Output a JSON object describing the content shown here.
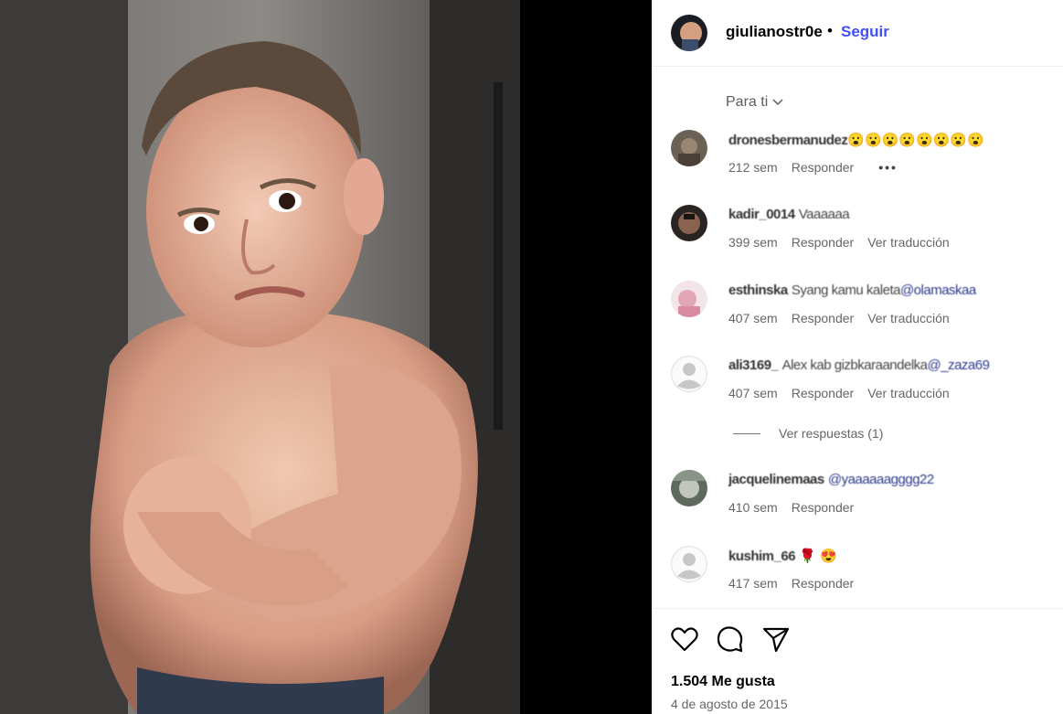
{
  "post": {
    "author": "giulianostr0e",
    "follow_label": "Seguir",
    "separator": "•",
    "filter_label": "Para ti",
    "likes": "1.504 Me gusta",
    "date": "4 de agosto de 2015"
  },
  "reply_label": "Responder",
  "translate_label": "Ver traducción",
  "view_replies_label": "Ver respuestas (1)",
  "comments": [
    {
      "user": "dronesbermanudez",
      "text": "😮😮😮😮😮😮😮😮",
      "mention": "",
      "time": "212 sem"
    },
    {
      "user": "kadir_0014",
      "text": "Vaaaaaa",
      "mention": "",
      "time": "399 sem"
    },
    {
      "user": "esthinska",
      "text": "Syang kamu kaleta",
      "mention": "@olamaskaa",
      "time": "407 sem"
    },
    {
      "user": "ali3169_",
      "text": "Alex kab gizbkaraandelka",
      "mention": "@_zaza69",
      "time": "407 sem"
    },
    {
      "user": "jacquelinemaas",
      "text": "",
      "mention": "@yaaaaaagggg22",
      "time": "410 sem"
    },
    {
      "user": "kushim_66",
      "text": "🌹 😍",
      "mention": "",
      "time": "417 sem"
    }
  ]
}
